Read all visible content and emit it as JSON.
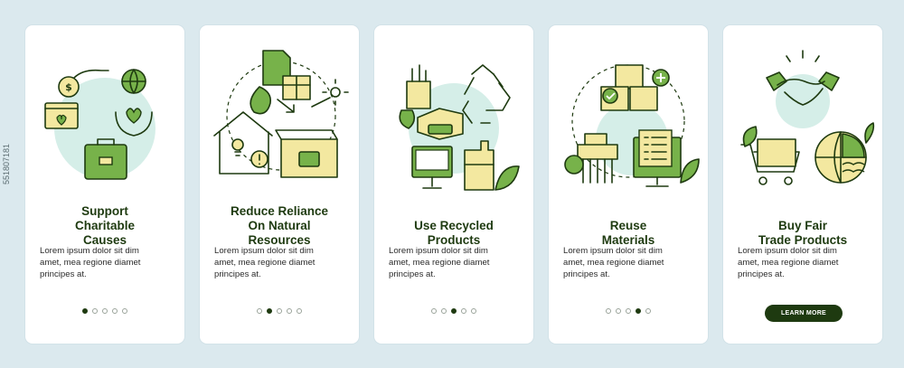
{
  "screens": [
    {
      "title_lines": [
        "Support",
        "Charitable",
        "Causes"
      ],
      "description_lines": [
        "Lorem ipsum dolor sit dim",
        "amet, mea regione diamet",
        "principes at."
      ],
      "active_dot": 0,
      "icon": "charity-icon"
    },
    {
      "title_lines": [
        "Reduce Reliance",
        "On Natural",
        "Resources"
      ],
      "description_lines": [
        "Lorem ipsum dolor sit dim",
        "amet, mea regione diamet",
        "principes at."
      ],
      "active_dot": 1,
      "icon": "natural-resources-icon"
    },
    {
      "title_lines": [
        "Use Recycled",
        "Products"
      ],
      "description_lines": [
        "Lorem ipsum dolor sit dim",
        "amet, mea regione diamet",
        "principes at."
      ],
      "active_dot": 2,
      "icon": "recycled-products-icon"
    },
    {
      "title_lines": [
        "Reuse",
        "Materials"
      ],
      "description_lines": [
        "Lorem ipsum dolor sit dim",
        "amet, mea regione diamet",
        "principes at."
      ],
      "active_dot": 3,
      "icon": "reuse-materials-icon"
    },
    {
      "title_lines": [
        "Buy Fair",
        "Trade Products"
      ],
      "description_lines": [
        "Lorem ipsum dolor sit dim",
        "amet, mea regione diamet",
        "principes at."
      ],
      "cta_label": "LEARN MORE",
      "icon": "fair-trade-icon"
    }
  ],
  "pagination_total": 5,
  "side_text": "551807181",
  "colors": {
    "background": "#dbe9ee",
    "card": "#ffffff",
    "dark_green": "#1e3a10",
    "green": "#77b24a",
    "yellow": "#f3e8a0",
    "mint": "#d5eee8"
  }
}
